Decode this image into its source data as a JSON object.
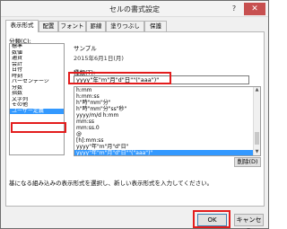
{
  "window": {
    "title": "セルの書式設定",
    "help_label": "?",
    "close_label": "✕"
  },
  "tabs": [
    "表示形式",
    "配置",
    "フォント",
    "罫線",
    "塗りつぶし",
    "保護"
  ],
  "category_label": "分類(C):",
  "categories": [
    "標準",
    "数値",
    "通貨",
    "会計",
    "日付",
    "時刻",
    "パーセンテージ",
    "分数",
    "指数",
    "文字列",
    "その他",
    "ユーザー定義"
  ],
  "sample": {
    "label": "サンプル",
    "value": "2015年6月1日(月)"
  },
  "type": {
    "label": "種類(T):",
    "input_value": "yyyy\"年\"m\"月\"d\"日\"\"(\"aaa\")\"",
    "list": [
      "h:mm",
      "h:mm:ss",
      "h\"時\"mm\"分\"",
      "h\"時\"mm\"分\"ss\"秒\"",
      "yyyy/m/d h:mm",
      "mm:ss",
      "mm:ss.0",
      "@",
      "[h]:mm:ss",
      "yyyy\"年\"m\"月\"d\"日\"",
      "yyyy\"年\"m\"月\"d\"日\"\"(\"aaa\")\""
    ]
  },
  "delete_label": "削除(D)",
  "description": "基になる組み込みの表示形式を選択し、新しい表示形式を入力してください。",
  "buttons": {
    "ok": "OK",
    "cancel": "キャンセル"
  },
  "colors": {
    "highlight_red": "#e31c1c",
    "selection_blue": "#3399ff"
  },
  "icons": {
    "close": "close-icon",
    "scroll_up": "scroll-up-icon",
    "scroll_down": "scroll-down-icon"
  }
}
